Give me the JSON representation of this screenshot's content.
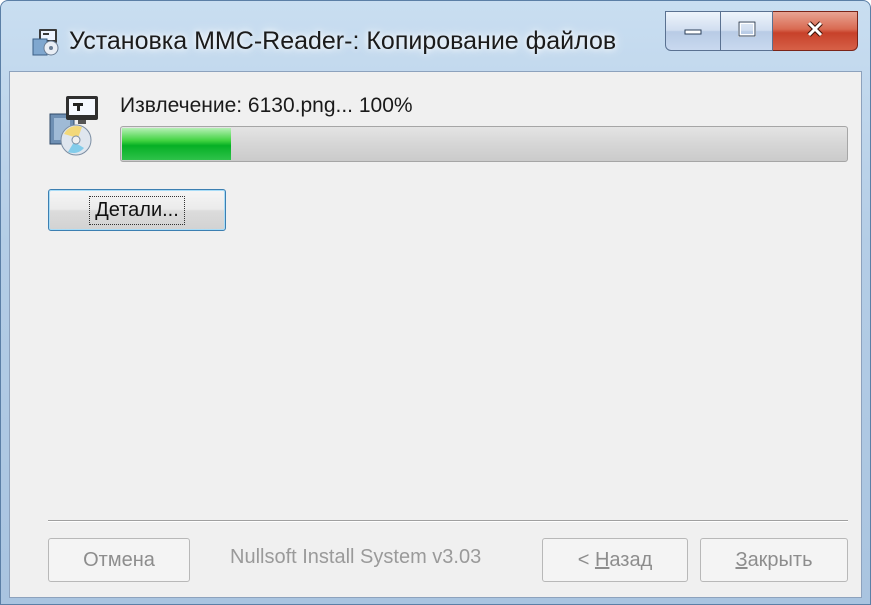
{
  "window": {
    "title": "Установка MMC-Reader-: Копирование файлов",
    "icon": "installer-app-icon",
    "controls": {
      "minimize": "minimize-icon",
      "maximize": "maximize-icon",
      "close": "close-icon"
    }
  },
  "install": {
    "status_text": "Извлечение: 6130.png... 100%",
    "icon": "installer-cd-icon",
    "progress_fraction": 0.15,
    "details_button": {
      "access_key": "Д",
      "rest": "етали..."
    }
  },
  "footer": {
    "branding": "Nullsoft Install System v3.03",
    "cancel_label": "Отмена",
    "back_button": {
      "prefix": "< ",
      "access_key": "Н",
      "rest": "азад"
    },
    "close_button": {
      "access_key": "З",
      "rest": "акрыть"
    }
  },
  "colors": {
    "progress_fill": "#06b025",
    "title_bar": "#b4cde6",
    "close_button": "#c7412a"
  }
}
